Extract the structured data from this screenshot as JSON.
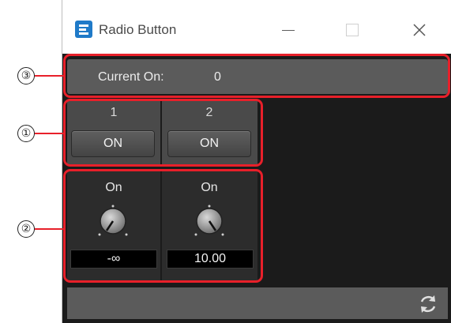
{
  "window": {
    "title": "Radio Button",
    "controls": {
      "minimize": "minimize",
      "maximize": "maximize",
      "close": "✕"
    }
  },
  "current": {
    "label": "Current On:",
    "value": "0"
  },
  "channels": [
    {
      "number": "1",
      "button_label": "ON",
      "knob_label": "On",
      "value": "-∞"
    },
    {
      "number": "2",
      "button_label": "ON",
      "knob_label": "On",
      "value": "10.00"
    }
  ],
  "callouts": [
    "③",
    "①",
    "②"
  ],
  "icons": {
    "app": "app-logo-icon",
    "refresh": "refresh-icon"
  },
  "colors": {
    "annotation": "#e8202a",
    "accent": "#1f7ac8"
  }
}
